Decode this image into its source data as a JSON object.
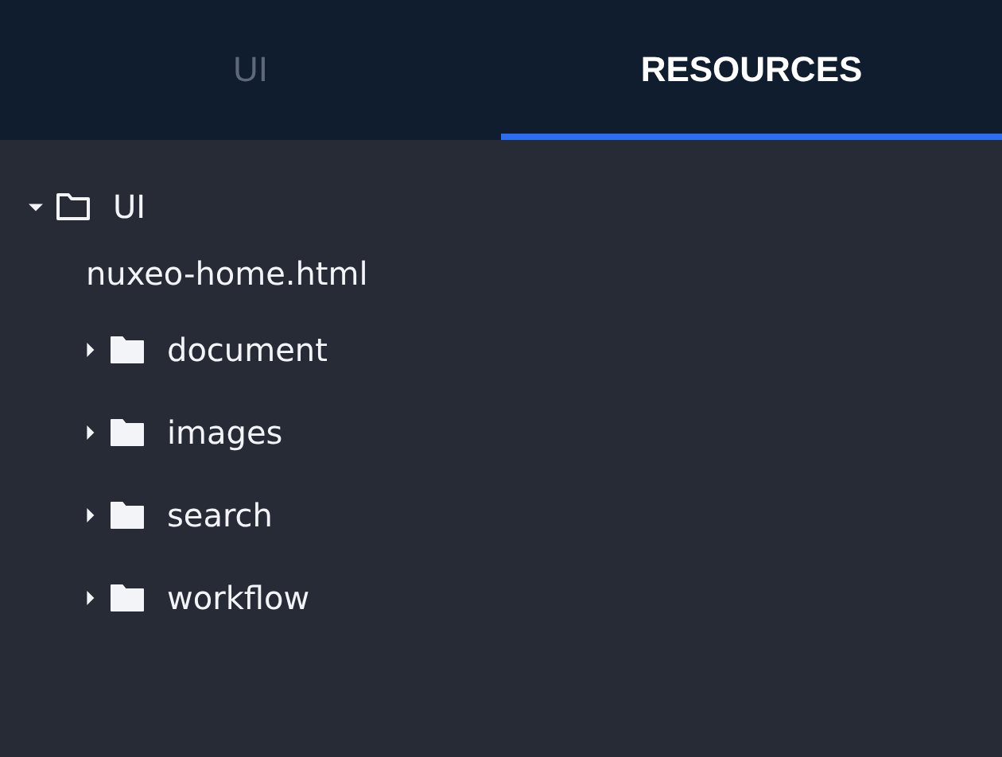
{
  "tabs": [
    {
      "label": "UI",
      "selected": false
    },
    {
      "label": "RESOURCES",
      "selected": true
    }
  ],
  "tree": [
    {
      "kind": "folder",
      "label": "UI",
      "expanded": true,
      "children": [
        {
          "kind": "file",
          "label": "nuxeo-home.html"
        },
        {
          "kind": "folder",
          "label": "document",
          "expanded": false
        },
        {
          "kind": "folder",
          "label": "images",
          "expanded": false
        },
        {
          "kind": "folder",
          "label": "search",
          "expanded": false
        },
        {
          "kind": "folder",
          "label": "workflow",
          "expanded": false
        }
      ]
    }
  ]
}
